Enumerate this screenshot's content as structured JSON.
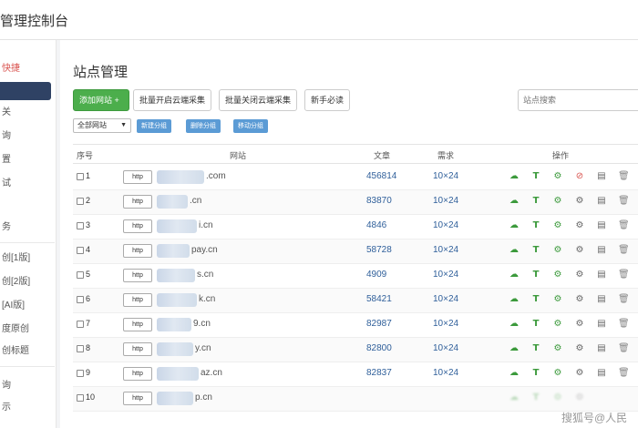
{
  "app": {
    "title": "管理控制台"
  },
  "sidebar": {
    "items": [
      {
        "label": "快捷",
        "style": "red"
      },
      {
        "label": "",
        "style": "active"
      },
      {
        "label": "关",
        "style": ""
      },
      {
        "label": "询",
        "style": ""
      },
      {
        "label": "置",
        "style": ""
      },
      {
        "label": "试",
        "style": ""
      },
      {
        "label": "",
        "style": ""
      },
      {
        "label": "务",
        "style": ""
      },
      {
        "label": "创[1版]",
        "style": ""
      },
      {
        "label": "创[2版]",
        "style": ""
      },
      {
        "label": "[AI版]",
        "style": ""
      },
      {
        "label": "度原创",
        "style": ""
      },
      {
        "label": "创标题",
        "style": ""
      },
      {
        "label": "询",
        "style": ""
      },
      {
        "label": "示",
        "style": ""
      }
    ]
  },
  "main": {
    "title": "站点管理",
    "toolbar": {
      "add_label": "添加网站 +",
      "batch_open_label": "批量开启云端采集",
      "batch_close_label": "批量关闭云端采集",
      "guide_label": "新手必读"
    },
    "search": {
      "placeholder": "站点搜索"
    },
    "filter": {
      "select_value": "全部网站",
      "new_group_label": "新建分组",
      "delete_group_label": "删除分组",
      "move_group_label": "移动分组"
    },
    "table": {
      "columns": {
        "index": "序号",
        "site": "网站",
        "articles": "文章",
        "requests": "需求",
        "actions": "操作"
      },
      "rows": [
        {
          "num": "1",
          "proto": "http",
          "url": ".com",
          "articles": "456814",
          "requests": "10×24"
        },
        {
          "num": "2",
          "proto": "http",
          "url": ".cn",
          "articles": "83870",
          "requests": "10×24"
        },
        {
          "num": "3",
          "proto": "http",
          "url": "i.cn",
          "articles": "4846",
          "requests": "10×24"
        },
        {
          "num": "4",
          "proto": "http",
          "url": "pay.cn",
          "articles": "58728",
          "requests": "10×24"
        },
        {
          "num": "5",
          "proto": "http",
          "url": "s.cn",
          "articles": "4909",
          "requests": "10×24"
        },
        {
          "num": "6",
          "proto": "http",
          "url": "k.cn",
          "articles": "58421",
          "requests": "10×24"
        },
        {
          "num": "7",
          "proto": "http",
          "url": "9.cn",
          "articles": "82987",
          "requests": "10×24"
        },
        {
          "num": "8",
          "proto": "http",
          "url": "y.cn",
          "articles": "82800",
          "requests": "10×24"
        },
        {
          "num": "9",
          "proto": "http",
          "url": "az.cn",
          "articles": "82837",
          "requests": "10×24"
        },
        {
          "num": "10",
          "proto": "http",
          "url": "p.cn",
          "articles": "",
          "requests": ""
        }
      ]
    }
  },
  "watermark": "搜狐号@人民"
}
